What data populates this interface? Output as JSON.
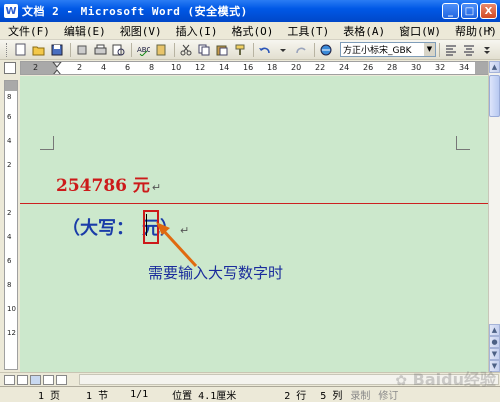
{
  "window": {
    "title": "文档 2 - Microsoft Word (安全模式)",
    "controls": {
      "minimize": "_",
      "maximize": "□",
      "close": "X"
    }
  },
  "menubar": {
    "items": [
      "文件(F)",
      "编辑(E)",
      "视图(V)",
      "插入(I)",
      "格式(O)",
      "工具(T)",
      "表格(A)",
      "窗口(W)",
      "帮助(H)"
    ],
    "close_glyph": "×"
  },
  "toolbar": {
    "font_name": "方正小标宋_GBK"
  },
  "ruler": {
    "h_numbers": [
      "2",
      "2",
      "4",
      "6",
      "8",
      "10",
      "12",
      "14",
      "16",
      "18",
      "20",
      "22",
      "24",
      "26",
      "28",
      "30",
      "32",
      "34"
    ],
    "v_numbers": [
      "8",
      "6",
      "4",
      "2",
      "2",
      "4",
      "6",
      "8",
      "10",
      "12"
    ]
  },
  "document": {
    "amount_text": "254786 元",
    "para_mark": "↵",
    "upper_prefix": "（大写：",
    "upper_suffix": "元）",
    "annotation": "需要输入大写数字时"
  },
  "statusbar": {
    "page": "1 页",
    "section": "1 节",
    "page_of": "1/1",
    "position": "位置 4.1厘米",
    "line": "2 行",
    "column": "5 列",
    "rec": "录制",
    "trk": "修订"
  },
  "watermark": {
    "text": "Baidu经验"
  },
  "colors": {
    "doc_background": "#cce8cc",
    "amount": "#cc1a1a",
    "upper_text": "#1a3ca8",
    "annotation_text": "#1a2c9c",
    "arrow": "#e06a10",
    "titlebar": "#0058e6"
  }
}
